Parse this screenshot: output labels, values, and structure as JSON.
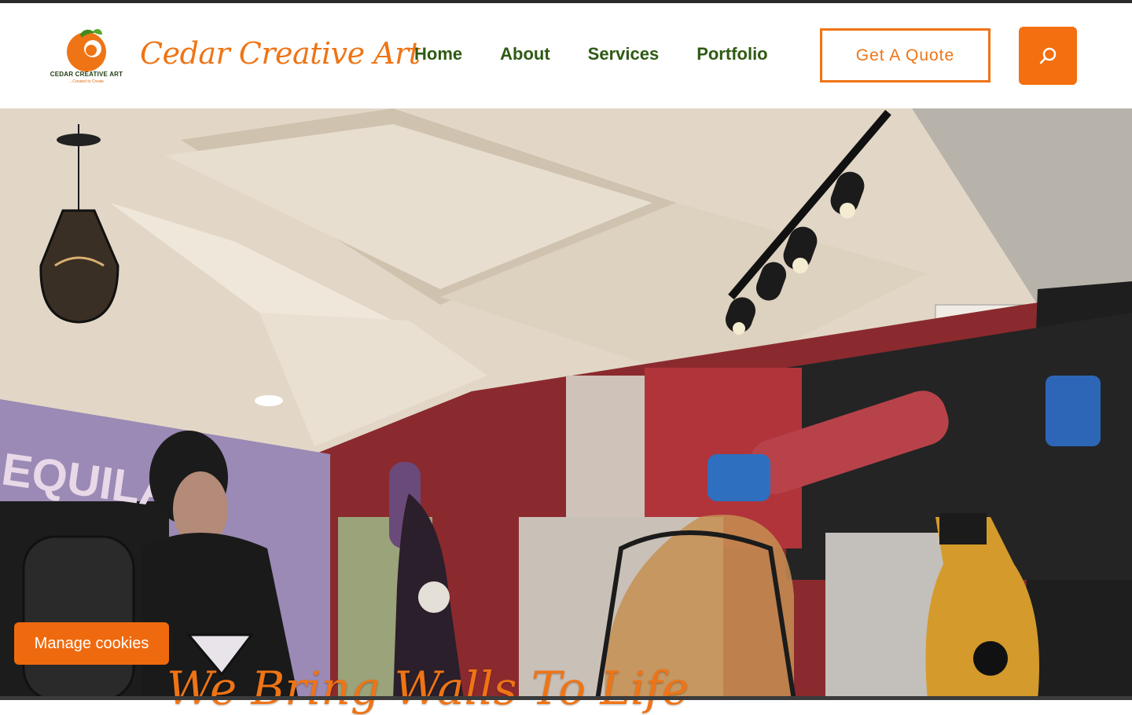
{
  "brand": {
    "site_title": "Cedar Creative Art",
    "logo_caption": "CEDAR CREATIVE ART",
    "logo_tagline": "...Created to Create",
    "accent_color": "#ef7415",
    "nav_color": "#2e5a14"
  },
  "nav": {
    "items": [
      {
        "label": "Home"
      },
      {
        "label": "About"
      },
      {
        "label": "Services"
      },
      {
        "label": "Portfolio"
      }
    ]
  },
  "header": {
    "quote_label": "Get A Quote",
    "search_icon": "search-icon"
  },
  "hero": {
    "image": "mural-interior-photo",
    "headline": "We Bring Walls To Life"
  },
  "cookies": {
    "button_label": "Manage cookies"
  }
}
